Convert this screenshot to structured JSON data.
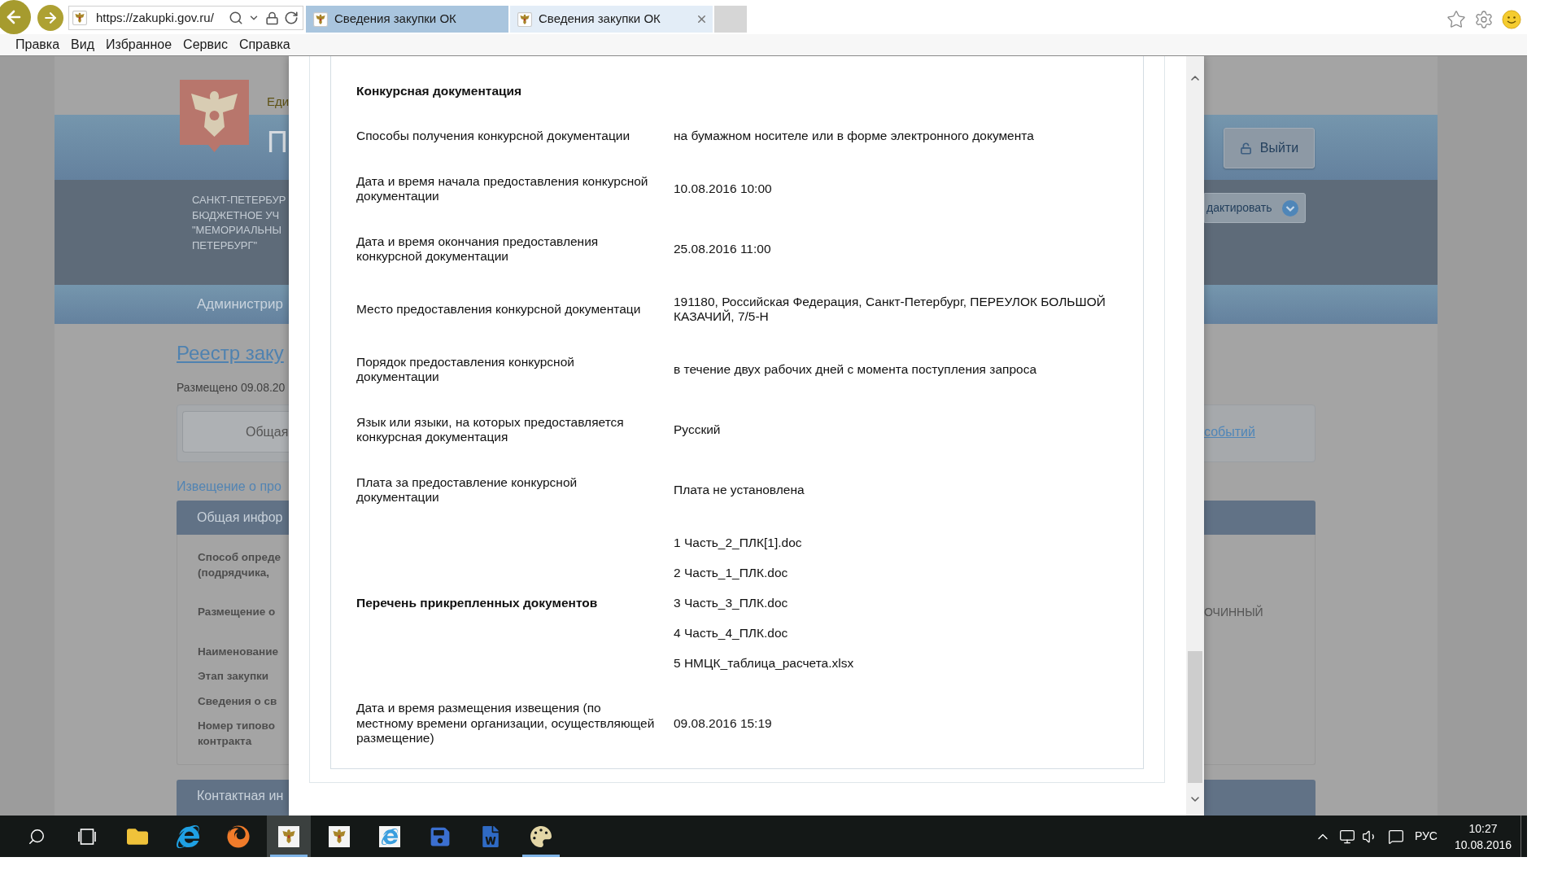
{
  "browser": {
    "address_bar": {
      "value": "https://zakupki.gov.ru/"
    },
    "tabs": [
      {
        "label": "Сведения закупки ОК",
        "selected": false
      },
      {
        "label": "Сведения закупки ОК",
        "selected": true
      }
    ],
    "menu": [
      "Правка",
      "Вид",
      "Избранное",
      "Сервис",
      "Справка"
    ]
  },
  "background_page": {
    "header": {
      "portal_title": "Еди",
      "page_title": "П",
      "organization_lines": [
        "САНКТ-ПЕТЕРБУР",
        "БЮДЖЕТНОЕ УЧ",
        "\"МЕМОРИАЛЬНЫ",
        "ПЕТЕРБУРГ\""
      ],
      "logout_button": "Выйти",
      "edit_button": "дактировать"
    },
    "nav_item": "Администрир",
    "registry_link": "Реестр заку",
    "posted": "Размещено 09.08.20",
    "tabs": [
      {
        "label": "Общая",
        "selected": true
      },
      {
        "label": "событий",
        "selected": false
      }
    ],
    "notice_title": "Извещение о про",
    "general_info": {
      "title": "Общая инфор",
      "rows": [
        {
          "label_lines": [
            "Способ опреде",
            "(подрядчика,"
          ]
        },
        {
          "label_lines": [
            "Размещение о"
          ],
          "value": "ОЧИННЫЙ"
        },
        {
          "label_lines": [
            "Наименование"
          ]
        },
        {
          "label_lines": [
            "Этап закупки"
          ]
        },
        {
          "label_lines": [
            "Сведения о св"
          ]
        },
        {
          "label_lines": [
            "Номер типово",
            "контракта"
          ]
        }
      ]
    },
    "contact_title": "Контактная ин"
  },
  "modal": {
    "section_title": "Конкурсная документация",
    "rows": [
      {
        "kind": "text",
        "label_lines": [
          "Способы получения конкурсной документации"
        ],
        "value_lines": [
          "на бумажном носителе или в форме электронного документа"
        ]
      },
      {
        "kind": "text",
        "label_lines": [
          "Дата и время начала предоставления конкурсной",
          "документации"
        ],
        "value_lines": [
          "10.08.2016 10:00"
        ]
      },
      {
        "kind": "text",
        "label_lines": [
          "Дата и время окончания предоставления",
          "конкурсной документации"
        ],
        "value_lines": [
          "25.08.2016 11:00"
        ]
      },
      {
        "kind": "text",
        "label_lines": [
          "Место предоставления конкурсной документаци"
        ],
        "value_lines": [
          "191180, Российская Федерация, Санкт-Петербург, ПЕРЕУЛОК БОЛЬШОЙ",
          "КАЗАЧИЙ, 7/5-Н"
        ]
      },
      {
        "kind": "text",
        "label_lines": [
          "Порядок предоставления конкурсной",
          "документации"
        ],
        "value_lines": [
          "в течение двух рабочих дней с момента поступления запроса"
        ]
      },
      {
        "kind": "text",
        "label_lines": [
          "Язык или языки, на которых предоставляется",
          "конкурсная документация"
        ],
        "value_lines": [
          "Русский"
        ]
      },
      {
        "kind": "text",
        "label_lines": [
          "Плата за предоставление конкурсной",
          "документации"
        ],
        "value_lines": [
          "Плата не установлена"
        ]
      },
      {
        "kind": "files",
        "label_lines": [
          "Перечень прикрепленных документов"
        ],
        "files": [
          "1 Часть_2_ПЛК[1].doc",
          "2 Часть_1_ПЛК.doc",
          "3 Часть_3_ПЛК.doc",
          "4 Часть_4_ПЛК.doc",
          "5 НМЦК_таблица_расчета.xlsx"
        ]
      },
      {
        "kind": "text",
        "label_lines": [
          "Дата и время размещения извещения (по",
          "местному времени организации, осуществляющей",
          "размещение)"
        ],
        "value_lines": [
          "09.08.2016 15:19"
        ]
      }
    ]
  },
  "taskbar": {
    "apps": [
      {
        "running": false,
        "selected": false
      },
      {
        "running": false,
        "selected": false
      },
      {
        "running": false,
        "selected": false
      },
      {
        "running": true,
        "selected": true
      },
      {
        "running": false,
        "selected": false
      },
      {
        "running": false,
        "selected": false
      },
      {
        "running": false,
        "selected": false
      },
      {
        "running": false,
        "selected": false
      },
      {
        "running": true,
        "selected": false
      }
    ],
    "tray": {
      "language": "РУС",
      "time": "10:27",
      "date": "10.08.2016"
    }
  }
}
